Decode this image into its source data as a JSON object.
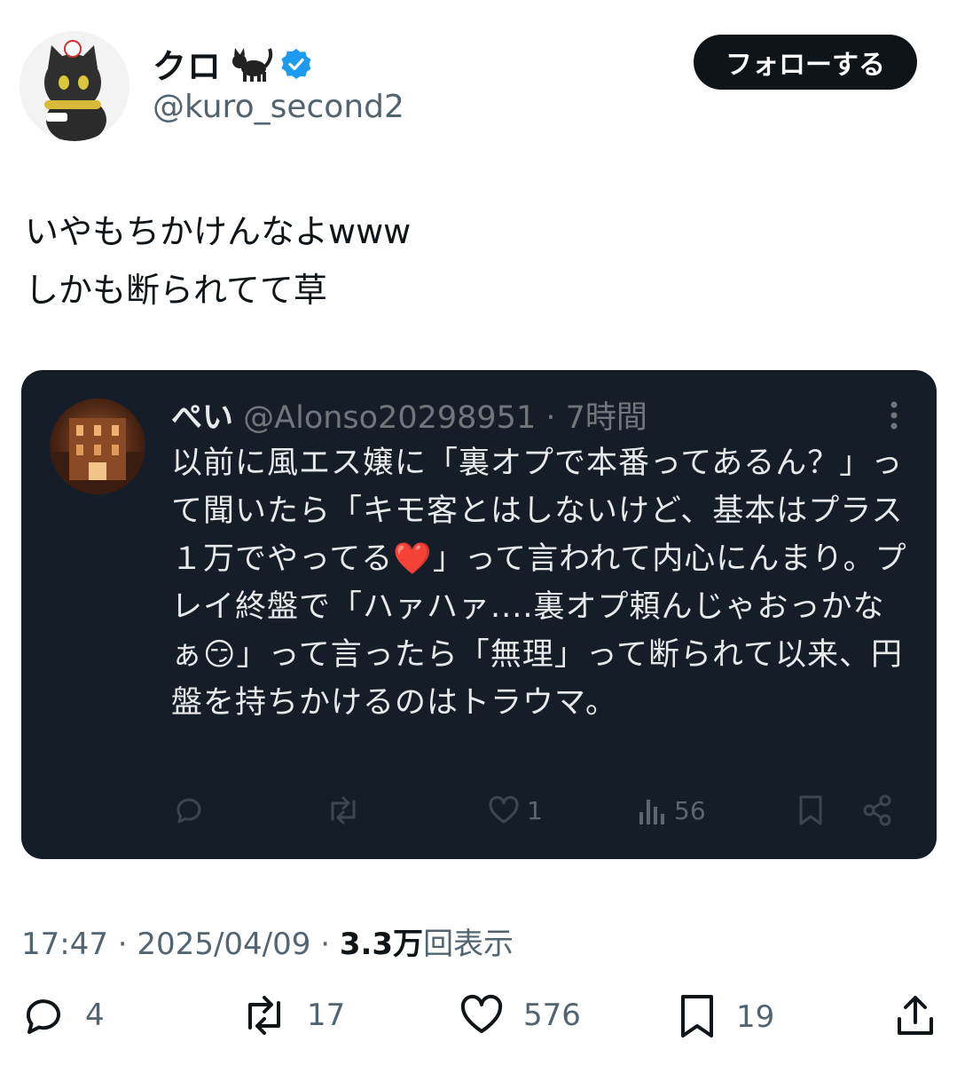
{
  "author": {
    "display_name": "クロ",
    "handle": "@kuro_second2",
    "verified": true,
    "name_emoji": "black-cat-emoji"
  },
  "follow_button_label": "フォローする",
  "tweet_text": "いやもちかけんなよwww\nしかも断られてて草",
  "quoted": {
    "display_name": "ぺい",
    "handle": "@Alonso20298951",
    "separator": "·",
    "time": "7時間",
    "text": "以前に風エス嬢に「裏オプで本番ってあるん？」って聞いたら「キモ客とはしないけど、基本はプラス１万でやってる❤️」って言われて内心にんまり。プレイ終盤で「ハァハァ....裏オプ頼んじゃおっかなぁ😏」って言ったら「無理」って断られて以来、円盤を持ちかけるのはトラウマ。",
    "likes": "1",
    "views": "56"
  },
  "meta": {
    "time": "17:47",
    "sep1": " · ",
    "date": "2025/04/09",
    "sep2": " · ",
    "views_count": "3.3万",
    "views_label": "回表示"
  },
  "actions": {
    "replies": "4",
    "reposts": "17",
    "likes": "576",
    "bookmarks": "19"
  },
  "colors": {
    "follow_bg": "#0f1419",
    "verified": "#1d9bf0",
    "card_bg": "#151d29",
    "muted": "#536471"
  }
}
